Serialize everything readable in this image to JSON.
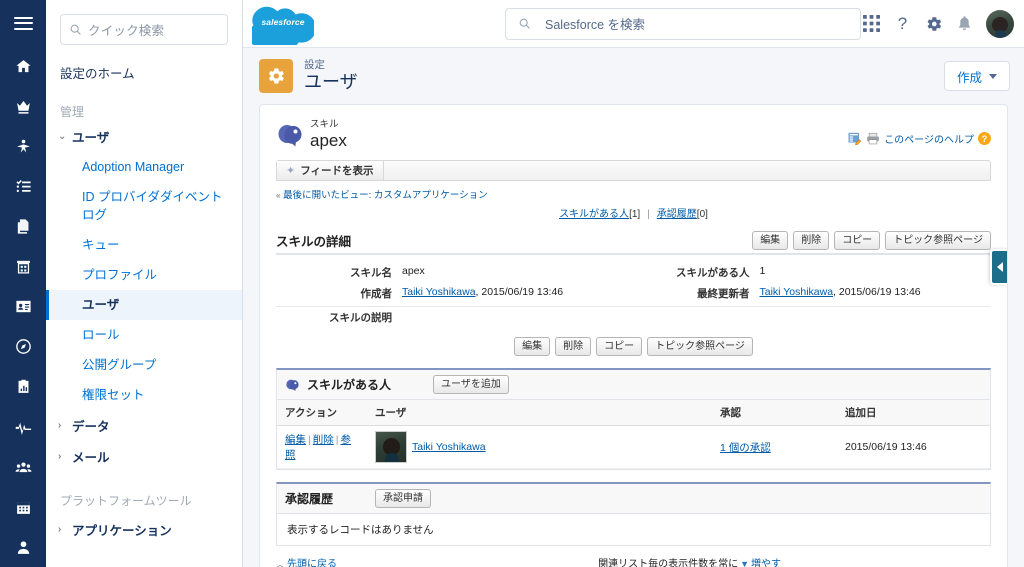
{
  "global_header": {
    "logo_text": "salesforce",
    "search": {
      "placeholder": "Salesforce を検索",
      "icon": "search-icon"
    },
    "icons": [
      {
        "name": "app-launcher-icon",
        "label": "アプリケーションランチャー"
      },
      {
        "name": "help-icon",
        "label": "?"
      },
      {
        "name": "gear-icon",
        "label": "設定"
      },
      {
        "name": "notifications-bell-icon",
        "label": "通知"
      }
    ],
    "avatar": "user-avatar"
  },
  "rail": {
    "menu_icon": "hamburger-menu-icon",
    "items": [
      {
        "name": "home-icon"
      },
      {
        "name": "crown-icon"
      },
      {
        "name": "star-person-icon"
      },
      {
        "name": "checklist-icon"
      },
      {
        "name": "files-icon"
      },
      {
        "name": "building-icon"
      },
      {
        "name": "contact-card-icon"
      },
      {
        "name": "compass-icon"
      },
      {
        "name": "reports-clipboard-icon"
      },
      {
        "name": "pulse-icon"
      },
      {
        "name": "groups-icon"
      },
      {
        "name": "calendar-icon"
      },
      {
        "name": "person-icon"
      }
    ]
  },
  "setup_nav": {
    "quick_find": {
      "placeholder": "クイック検索",
      "value": ""
    },
    "home_label": "設定のホーム",
    "sections": [
      {
        "label": "管理",
        "groups": [
          {
            "label": "ユーザ",
            "expanded": true,
            "chevron": "chevron-down-icon",
            "items": [
              {
                "label": "Adoption Manager",
                "selected": false
              },
              {
                "label": "ID プロバイダダイベントログ",
                "selected": false
              },
              {
                "label": "キュー",
                "selected": false
              },
              {
                "label": "プロファイル",
                "selected": false
              },
              {
                "label": "ユーザ",
                "selected": true
              },
              {
                "label": "ロール",
                "selected": false
              },
              {
                "label": "公開グループ",
                "selected": false
              },
              {
                "label": "権限セット",
                "selected": false
              }
            ]
          },
          {
            "label": "データ",
            "expanded": false,
            "chevron": "chevron-right-icon",
            "items": []
          },
          {
            "label": "メール",
            "expanded": false,
            "chevron": "chevron-right-icon",
            "items": []
          }
        ]
      },
      {
        "label": "プラットフォームツール",
        "groups": [
          {
            "label": "アプリケーション",
            "expanded": false,
            "chevron": "chevron-right-icon",
            "items": []
          }
        ]
      }
    ]
  },
  "page_header": {
    "icon": "setup-gear-icon",
    "kicker": "設定",
    "title": "ユーザ",
    "create_button": {
      "label": "作成",
      "icon": "caret-down-icon"
    }
  },
  "record": {
    "icon": "skill-head-icon",
    "kicker": "スキル",
    "title": "apex",
    "help": {
      "customize_icon": "customize-page-icon",
      "print_icon": "printer-icon",
      "link_label": "このページのヘルプ",
      "question_icon": "help-question-icon"
    },
    "feed_button": {
      "label": "フィードを表示",
      "icon": "feed-star-icon"
    },
    "last_view": {
      "prefix": "最後に開いたビュー:",
      "value": "カスタムアプリケーション",
      "arrow": "«"
    },
    "top_links": [
      {
        "label": "スキルがある人",
        "count": "[1]"
      },
      {
        "label": "承認履歴",
        "count": "[0]"
      }
    ]
  },
  "detail_section": {
    "title": "スキルの詳細",
    "buttons": [
      "編集",
      "削除",
      "コピー",
      "トピック参照ページ"
    ],
    "fields": [
      {
        "label": "スキル名",
        "value": "apex",
        "link": false
      },
      {
        "label": "スキルがある人",
        "value": "1",
        "link": false
      },
      {
        "label": "作成者",
        "link_text": "Taiki Yoshikawa",
        "value": ", 2015/06/19 13:46",
        "link": true
      },
      {
        "label": "最終更新者",
        "link_text": "Taiki Yoshikawa",
        "value": ", 2015/06/19 13:46",
        "link": true
      },
      {
        "label": "スキルの説明",
        "value": "",
        "link": false
      }
    ]
  },
  "skill_users_panel": {
    "icon": "skill-head-icon",
    "title": "スキルがある人",
    "button": "ユーザを追加",
    "columns": [
      "アクション",
      "ユーザ",
      "承認",
      "追加日"
    ],
    "rows": [
      {
        "actions": [
          "編集",
          "削除",
          "参照"
        ],
        "user_photo": "user-thumbnail",
        "user": "Taiki Yoshikawa",
        "endorsement": "1 個の承認",
        "added_date": "2015/06/19 13:46"
      }
    ]
  },
  "approval_panel": {
    "title": "承認履歴",
    "button": "承認申請",
    "empty_message": "表示するレコードはありません"
  },
  "footer": {
    "back_to_top": "先頭に戻る",
    "expand_prefix": "関連リスト毎の表示件数を常に",
    "expand_link": "増やす",
    "expand_icon": "caret-down-icon"
  },
  "side_tab": {
    "icon": "collapse-left-icon"
  },
  "colors": {
    "rail_bg": "#16325c",
    "accent_blue": "#0070d2",
    "link_blue": "#015ba7",
    "setup_orange": "#e8a33d",
    "panel_top": "#8296c1",
    "page_bg": "#f4f6f9"
  }
}
